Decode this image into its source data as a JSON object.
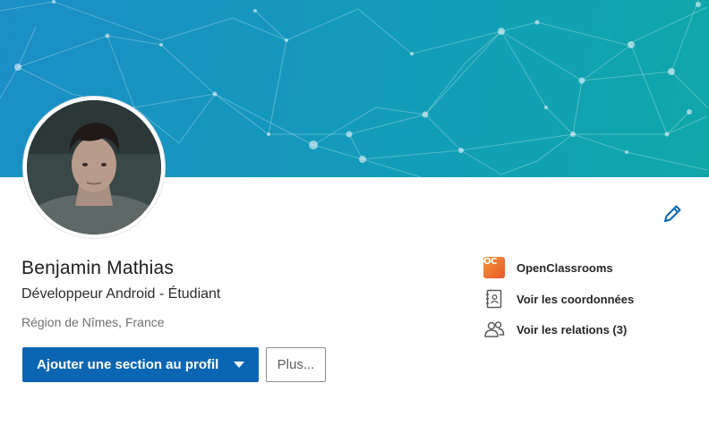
{
  "profile": {
    "name": "Benjamin Mathias",
    "headline": "Développeur Android - Étudiant",
    "location": "Région de Nîmes, France"
  },
  "actions": {
    "add_section_label": "Ajouter une section au profil",
    "more_label": "Plus..."
  },
  "sidebar": {
    "items": [
      {
        "label": "OpenClassrooms",
        "icon": "openclassrooms-logo"
      },
      {
        "label": "Voir les coordonnées",
        "icon": "contact-book-icon"
      },
      {
        "label": "Voir les relations (3)",
        "icon": "people-icon"
      }
    ]
  },
  "logo_text": "OC",
  "colors": {
    "primary": "#0a66b2",
    "banner_start": "#1b8fc6",
    "banner_end": "#10a7aa",
    "edit_icon": "#0a66b2"
  }
}
